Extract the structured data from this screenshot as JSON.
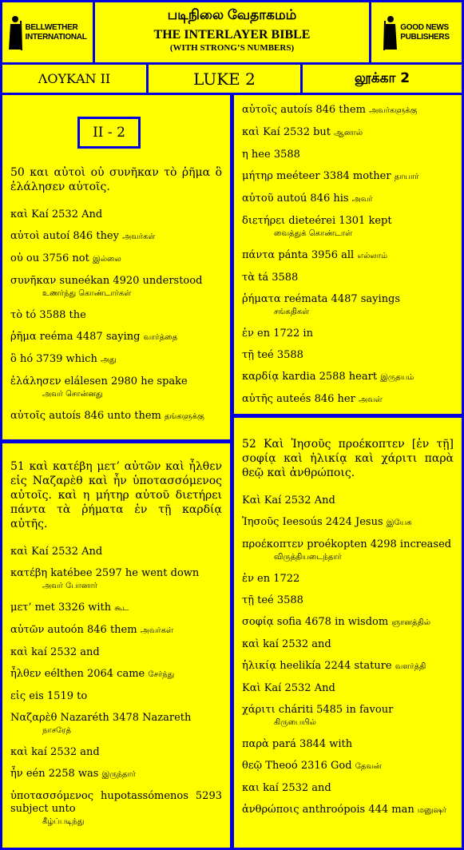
{
  "header": {
    "left_logo": [
      "BELLWETHER",
      "INTERNATIONAL"
    ],
    "title_tamil": "படிநிலை வேதாகமம்",
    "title_english": "THE   INTERLAYER BIBLE",
    "subtitle": "(WITH STRONG’S NUMBERS)",
    "right_logo": [
      "GOOD NEWS",
      "PUBLISHERS"
    ]
  },
  "titles": {
    "greek": "ΛΟΥΚΑΝ ΙΙ",
    "english": "LUKE 2",
    "tamil": "லூக்கா 2"
  },
  "reference": "II - 2",
  "col1": {
    "verse50": "50 και αὐτοὶ οὐ συνῆκαν τὸ ῥῆμα ὃ ἐλάλησεν αὐτοῖς.",
    "rows50": [
      {
        "text": "καὶ  Kaí 2532 And",
        "tamil": ""
      },
      {
        "text": "αὐτοὶ  autoí  846 they",
        "tamil": "அவர்கள்"
      },
      {
        "text": "οὐ  ou 3756 not",
        "tamil": "இல்லை"
      },
      {
        "text": "συνῆκαν  suneékan 4920 understood",
        "tamil": "உணர்ந்து கொண்டார்கள்"
      },
      {
        "text": "τὸ  tó 3588 the",
        "tamil": ""
      },
      {
        "text": "ῥῆμα  reéma 4487 saying",
        "tamil": "வார்த்தை"
      },
      {
        "text": "ὃ  hó 3739  which",
        "tamil": "அது"
      },
      {
        "text": "ἐλάλησεν  elálesen 2980 he spake",
        "tamil": "அவர் சொன்னது"
      },
      {
        "text": "αὐτοῖς  autoís 846 unto them",
        "tamil": "தங்களுக்கு"
      }
    ],
    "verse51": "51 καὶ κατέβη μετ’ αὐτῶν καὶ ἦλθεν εἰς Ναζαρὲθ καὶ ἦν ὑποτασσόμενος αὐτοῖς. καὶ η μήτηρ αὐτοῦ διετήρει πάντα τὰ ῥήματα ἐν τῇ καρδίᾳ αὐτῆς.",
    "rows51": [
      {
        "text": "καὶ  Kaí 2532 And",
        "tamil": ""
      },
      {
        "text": "κατέβη  katébee  2597  he went down",
        "tamil": "அவர் போனார்"
      },
      {
        "text": "μετ’  met 3326 with",
        "tamil": "கூட"
      },
      {
        "text": "αὐτῶν  autoón 846 them",
        "tamil": "அவர்கள்"
      },
      {
        "text": "καὶ  kaí 2532 and",
        "tamil": ""
      },
      {
        "text": "ἦλθεν  eélthen 2064 came",
        "tamil": "சேர்ந்து"
      },
      {
        "text": "εἰς  eis 1519 to",
        "tamil": ""
      },
      {
        "text": "Ναζαρὲθ  Nazaréth  3478  Nazareth",
        "tamil": "நாசரேத்"
      },
      {
        "text": "καὶ  kaí 2532 and",
        "tamil": ""
      },
      {
        "text": "ἦν  eén 2258 was",
        "tamil": "இருந்தார்"
      },
      {
        "text": "ὑποτασσόμενος  hupotassómenos  5293 subject unto",
        "tamil": "கீழ்ப்படிந்து"
      }
    ]
  },
  "col2": {
    "rows51b": [
      {
        "text": "αὐτοῖς  autoís 846 them",
        "tamil": "அவர்களுக்கு"
      },
      {
        "text": "καὶ  Kaí 2532 but",
        "tamil": "ஆனால்"
      },
      {
        "text": "η  hee 3588",
        "tamil": ""
      },
      {
        "text": "μήτηρ  meéteer 3384 mother",
        "tamil": "தாயார்"
      },
      {
        "text": "αὐτοῦ  autoú 846 his",
        "tamil": "அவர்"
      },
      {
        "text": "διετήρει  dieteérei  1301 kept",
        "tamil": "வைத்துக் கொண்டாள்"
      },
      {
        "text": "πάντα  pánta 3956 all",
        "tamil": "எல்லாம்"
      },
      {
        "text": "τὰ  tá 3588",
        "tamil": ""
      },
      {
        "text": "ῥήματα  reémata  4487  sayings",
        "tamil": "சங்கதிகள்"
      },
      {
        "text": "ἐν  en 1722  in",
        "tamil": ""
      },
      {
        "text": "τῇ  teé 3588",
        "tamil": ""
      },
      {
        "text": "καρδίᾳ  kardia 2588  heart",
        "tamil": "இருதயம்"
      },
      {
        "text": "αὐτῆς  auteés 846 her",
        "tamil": "அவள்"
      }
    ],
    "verse52": "52 Καὶ Ἰησοῦς προέκοπτεν [ἐν τῇ] σοφίᾳ καὶ ἡλικίᾳ καὶ χάριτι παρὰ θεῷ καὶ ἀνθρώποις.",
    "rows52": [
      {
        "text": "Καὶ  Kaí  2532 And",
        "tamil": ""
      },
      {
        "text": "Ἰησοῦς  Ieesoús 2424 Jesus",
        "tamil": "இயேசு"
      },
      {
        "text": "προέκοπτεν  proékopten  4298 increased",
        "tamil": "விருத்தியடைந்தார்"
      },
      {
        "text": "ἐν  en 1722",
        "tamil": ""
      },
      {
        "text": "τῇ  teé 3588",
        "tamil": ""
      },
      {
        "text": "σοφίᾳ  sofia 4678 in wisdom",
        "tamil": "ஞானத்தில்"
      },
      {
        "text": "καὶ  kaí 2532 and",
        "tamil": ""
      },
      {
        "text": "ἡλικίᾳ  heelikía 2244 stature",
        "tamil": "வளர்த்தி"
      },
      {
        "text": "Καὶ  Kaí  2532 And",
        "tamil": ""
      },
      {
        "text": "χάριτι  cháriti  5485  in favour",
        "tamil": "கிருபையில்"
      },
      {
        "text": "παρὰ  pará 3844 with",
        "tamil": ""
      },
      {
        "text": "θεῷ  Theoó  2316 God",
        "tamil": "தேவன்"
      },
      {
        "text": "και  kaí  2532 and",
        "tamil": ""
      },
      {
        "text": "ἀνθρώποις  anthroópois  444  man",
        "tamil": "மனுஷர்"
      }
    ]
  }
}
